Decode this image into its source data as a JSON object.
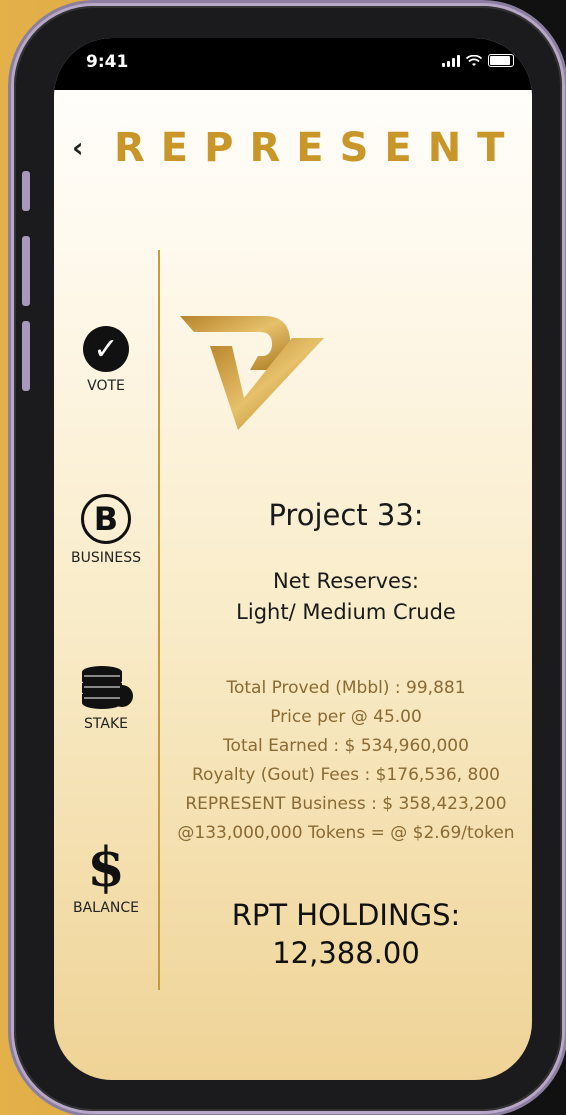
{
  "status": {
    "time": "9:41"
  },
  "app": {
    "back_symbol": "‹",
    "title": "REPRESENT"
  },
  "nav": {
    "items": [
      {
        "label": "VOTE",
        "icon": "check-circle-icon"
      },
      {
        "label": "BUSINESS",
        "icon": "b-circle-icon"
      },
      {
        "label": "STAKE",
        "icon": "coin-stack-icon"
      },
      {
        "label": "BALANCE",
        "icon": "dollar-icon"
      }
    ]
  },
  "project": {
    "title": "Project 33:",
    "reserves_line1": "Net Reserves:",
    "reserves_line2": "Light/ Medium Crude",
    "stats": [
      "Total Proved (Mbbl) : 99,881",
      "Price per @ 45.00",
      "Total Earned : $ 534,960,000",
      "Royalty (Gout) Fees : $176,536, 800",
      "REPRESENT Business : $ 358,423,200",
      "@133,000,000 Tokens = @ $2.69/token"
    ]
  },
  "holdings": {
    "label": "RPT HOLDINGS:",
    "value": "12,388.00"
  },
  "colors": {
    "gold": "#c9962a",
    "stat_text": "#8a6a33"
  }
}
